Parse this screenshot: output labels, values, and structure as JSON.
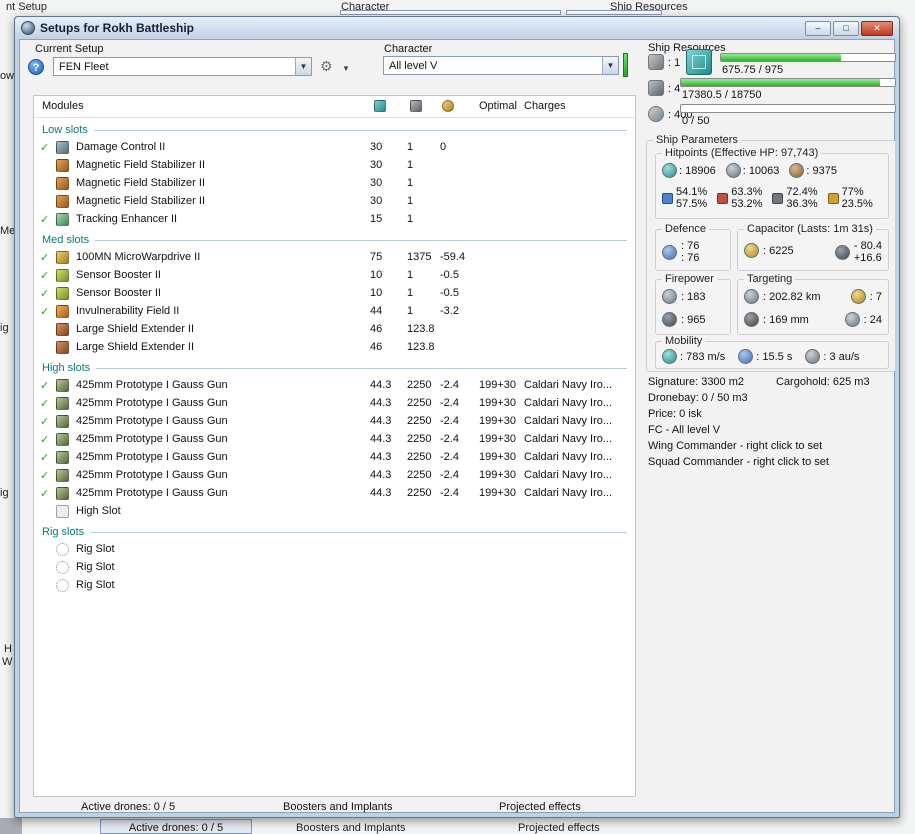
{
  "colors": {
    "accent_green": "#2db52d",
    "section_title": "#0b7a7a",
    "close_red": "#bb3a22",
    "bar_green": "#28b428"
  },
  "background_app": {
    "top": {
      "current_setup": "nt Setup",
      "character": "Character",
      "ship_resources": "Ship Resources"
    },
    "left_fragments": [
      "ow",
      "Me",
      "ig",
      "ig",
      "H",
      "W"
    ],
    "bottom": {
      "active_drones": "Active drones: 0 / 5",
      "boosters": "Boosters and Implants",
      "projected": "Projected effects"
    }
  },
  "window": {
    "title": "Setups for Rokh Battleship",
    "controls": {
      "minimize": "–",
      "maximize": "□",
      "close": "✕"
    },
    "bottom_tabs": {
      "active_drones": "Active drones: 0 / 5",
      "boosters": "Boosters and Implants",
      "projected": "Projected effects"
    }
  },
  "toolbar": {
    "current_setup_label": "Current Setup",
    "current_setup_value": "FEN Fleet",
    "help_glyph": "?",
    "tools_glyph": "⚙",
    "caret_glyph": "▼",
    "combo_arrow": "▼",
    "character_label": "Character",
    "character_value": "All level V"
  },
  "modules_table": {
    "columns": {
      "name": "Modules",
      "optimal": "Optimal",
      "charges": "Charges"
    },
    "sections": [
      {
        "id": "low",
        "title": "Low slots",
        "rows": [
          {
            "checked": true,
            "icon": "damage-control-icon",
            "name": "Damage Control II",
            "cpu": "30",
            "pg": "1",
            "cap": "0"
          },
          {
            "checked": false,
            "icon": "magnetic-field-stabilizer-icon",
            "name": "Magnetic Field Stabilizer II",
            "cpu": "30",
            "pg": "1"
          },
          {
            "checked": false,
            "icon": "magnetic-field-stabilizer-icon",
            "name": "Magnetic Field Stabilizer II",
            "cpu": "30",
            "pg": "1"
          },
          {
            "checked": false,
            "icon": "magnetic-field-stabilizer-icon",
            "name": "Magnetic Field Stabilizer II",
            "cpu": "30",
            "pg": "1"
          },
          {
            "checked": true,
            "icon": "tracking-enhancer-icon",
            "name": "Tracking Enhancer II",
            "cpu": "15",
            "pg": "1"
          }
        ]
      },
      {
        "id": "med",
        "title": "Med slots",
        "rows": [
          {
            "checked": true,
            "icon": "microwarpdrive-icon",
            "name": "100MN MicroWarpdrive II",
            "cpu": "75",
            "pg": "1375",
            "cap": "-59.4"
          },
          {
            "checked": true,
            "icon": "sensor-booster-icon",
            "name": "Sensor Booster II",
            "cpu": "10",
            "pg": "1",
            "cap": "-0.5"
          },
          {
            "checked": true,
            "icon": "sensor-booster-icon",
            "name": "Sensor Booster II",
            "cpu": "10",
            "pg": "1",
            "cap": "-0.5"
          },
          {
            "checked": true,
            "icon": "invulnerability-field-icon",
            "name": "Invulnerability Field II",
            "cpu": "44",
            "pg": "1",
            "cap": "-3.2"
          },
          {
            "checked": false,
            "icon": "shield-extender-icon",
            "name": "Large Shield Extender II",
            "cpu": "46",
            "pg": "123.8"
          },
          {
            "checked": false,
            "icon": "shield-extender-icon",
            "name": "Large Shield Extender II",
            "cpu": "46",
            "pg": "123.8"
          }
        ]
      },
      {
        "id": "high",
        "title": "High slots",
        "rows": [
          {
            "checked": true,
            "icon": "hybrid-turret-icon",
            "name": "425mm Prototype I Gauss Gun",
            "cpu": "44.3",
            "pg": "2250",
            "cap": "-2.4",
            "optimal": "199+30",
            "charge": "Caldari Navy Iro..."
          },
          {
            "checked": true,
            "icon": "hybrid-turret-icon",
            "name": "425mm Prototype I Gauss Gun",
            "cpu": "44.3",
            "pg": "2250",
            "cap": "-2.4",
            "optimal": "199+30",
            "charge": "Caldari Navy Iro..."
          },
          {
            "checked": true,
            "icon": "hybrid-turret-icon",
            "name": "425mm Prototype I Gauss Gun",
            "cpu": "44.3",
            "pg": "2250",
            "cap": "-2.4",
            "optimal": "199+30",
            "charge": "Caldari Navy Iro..."
          },
          {
            "checked": true,
            "icon": "hybrid-turret-icon",
            "name": "425mm Prototype I Gauss Gun",
            "cpu": "44.3",
            "pg": "2250",
            "cap": "-2.4",
            "optimal": "199+30",
            "charge": "Caldari Navy Iro..."
          },
          {
            "checked": true,
            "icon": "hybrid-turret-icon",
            "name": "425mm Prototype I Gauss Gun",
            "cpu": "44.3",
            "pg": "2250",
            "cap": "-2.4",
            "optimal": "199+30",
            "charge": "Caldari Navy Iro..."
          },
          {
            "checked": true,
            "icon": "hybrid-turret-icon",
            "name": "425mm Prototype I Gauss Gun",
            "cpu": "44.3",
            "pg": "2250",
            "cap": "-2.4",
            "optimal": "199+30",
            "charge": "Caldari Navy Iro..."
          },
          {
            "checked": true,
            "icon": "hybrid-turret-icon",
            "name": "425mm Prototype I Gauss Gun",
            "cpu": "44.3",
            "pg": "2250",
            "cap": "-2.4",
            "optimal": "199+30",
            "charge": "Caldari Navy Iro..."
          },
          {
            "checked": false,
            "icon": "empty-highslot-icon",
            "name": "High Slot"
          }
        ]
      },
      {
        "id": "rig",
        "title": "Rig slots",
        "rows": [
          {
            "checked": false,
            "icon": "rig-slot-icon",
            "name": "Rig Slot"
          },
          {
            "checked": false,
            "icon": "rig-slot-icon",
            "name": "Rig Slot"
          },
          {
            "checked": false,
            "icon": "rig-slot-icon",
            "name": "Rig Slot"
          }
        ]
      }
    ]
  },
  "ship_resources": {
    "title": "Ship Resources",
    "turret_hardpoints": ": 1",
    "launcher_hardpoints": ": 4",
    "calibration": ": 400",
    "cpu_bar": {
      "label": "675.75 / 975",
      "percent": 69
    },
    "powergrid_bar": {
      "label": "17380.5 / 18750",
      "percent": 93
    },
    "calibration_bar": {
      "label": "0 / 50",
      "percent": 0
    }
  },
  "ship_parameters": {
    "title": "Ship Parameters",
    "hitpoints": {
      "title": "Hitpoints (Effective HP: 97,743)",
      "shield": ": 18906",
      "armor": ": 10063",
      "structure": ": 9375",
      "resists": [
        {
          "icon": "em-resist-icon",
          "shield": "54.1%",
          "armor": "57.5%"
        },
        {
          "icon": "thermal-resist-icon",
          "shield": "63.3%",
          "armor": "53.2%"
        },
        {
          "icon": "kinetic-resist-icon",
          "shield": "72.4%",
          "armor": "36.3%"
        },
        {
          "icon": "explosive-resist-icon",
          "shield": "77%",
          "armor": "23.5%"
        }
      ]
    },
    "defence": {
      "title": "Defence",
      "value1": ": 76",
      "value2": ": 76"
    },
    "capacitor": {
      "title": "Capacitor (Lasts: 1m 31s)",
      "amount": ": 6225",
      "outflow": "- 80.4",
      "inflow": "+16.6"
    },
    "firepower": {
      "title": "Firepower",
      "dps": ": 183",
      "volley": ": 965"
    },
    "targeting": {
      "title": "Targeting",
      "range": ": 202.82 km",
      "max_targets": ": 7",
      "scan_resolution": ": 169 mm",
      "sensor_strength": ": 24"
    },
    "mobility": {
      "title": "Mobility",
      "speed": ": 783 m/s",
      "align_time": ": 15.5 s",
      "warp_speed": ": 3 au/s"
    },
    "info": {
      "signature": "Signature: 3300 m2",
      "cargohold": "Cargohold: 625 m3",
      "dronebay": "Dronebay: 0 / 50 m3",
      "price": "Price: 0 isk",
      "fc": "FC - All level V",
      "wing": "Wing Commander - right click to set",
      "squad": "Squad Commander - right click to set"
    }
  }
}
